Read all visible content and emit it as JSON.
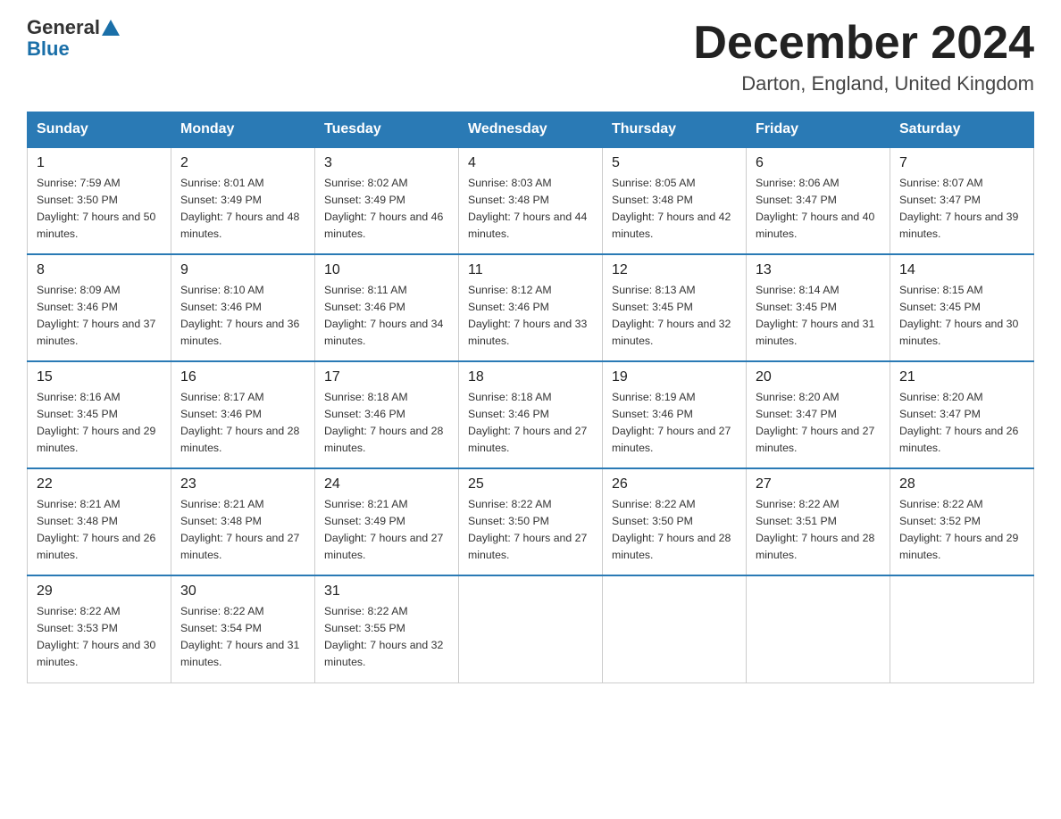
{
  "header": {
    "logo_general": "General",
    "logo_blue": "Blue",
    "month_title": "December 2024",
    "location": "Darton, England, United Kingdom"
  },
  "weekdays": [
    "Sunday",
    "Monday",
    "Tuesday",
    "Wednesday",
    "Thursday",
    "Friday",
    "Saturday"
  ],
  "weeks": [
    [
      {
        "day": 1,
        "sunrise": "7:59 AM",
        "sunset": "3:50 PM",
        "daylight": "7 hours and 50 minutes."
      },
      {
        "day": 2,
        "sunrise": "8:01 AM",
        "sunset": "3:49 PM",
        "daylight": "7 hours and 48 minutes."
      },
      {
        "day": 3,
        "sunrise": "8:02 AM",
        "sunset": "3:49 PM",
        "daylight": "7 hours and 46 minutes."
      },
      {
        "day": 4,
        "sunrise": "8:03 AM",
        "sunset": "3:48 PM",
        "daylight": "7 hours and 44 minutes."
      },
      {
        "day": 5,
        "sunrise": "8:05 AM",
        "sunset": "3:48 PM",
        "daylight": "7 hours and 42 minutes."
      },
      {
        "day": 6,
        "sunrise": "8:06 AM",
        "sunset": "3:47 PM",
        "daylight": "7 hours and 40 minutes."
      },
      {
        "day": 7,
        "sunrise": "8:07 AM",
        "sunset": "3:47 PM",
        "daylight": "7 hours and 39 minutes."
      }
    ],
    [
      {
        "day": 8,
        "sunrise": "8:09 AM",
        "sunset": "3:46 PM",
        "daylight": "7 hours and 37 minutes."
      },
      {
        "day": 9,
        "sunrise": "8:10 AM",
        "sunset": "3:46 PM",
        "daylight": "7 hours and 36 minutes."
      },
      {
        "day": 10,
        "sunrise": "8:11 AM",
        "sunset": "3:46 PM",
        "daylight": "7 hours and 34 minutes."
      },
      {
        "day": 11,
        "sunrise": "8:12 AM",
        "sunset": "3:46 PM",
        "daylight": "7 hours and 33 minutes."
      },
      {
        "day": 12,
        "sunrise": "8:13 AM",
        "sunset": "3:45 PM",
        "daylight": "7 hours and 32 minutes."
      },
      {
        "day": 13,
        "sunrise": "8:14 AM",
        "sunset": "3:45 PM",
        "daylight": "7 hours and 31 minutes."
      },
      {
        "day": 14,
        "sunrise": "8:15 AM",
        "sunset": "3:45 PM",
        "daylight": "7 hours and 30 minutes."
      }
    ],
    [
      {
        "day": 15,
        "sunrise": "8:16 AM",
        "sunset": "3:45 PM",
        "daylight": "7 hours and 29 minutes."
      },
      {
        "day": 16,
        "sunrise": "8:17 AM",
        "sunset": "3:46 PM",
        "daylight": "7 hours and 28 minutes."
      },
      {
        "day": 17,
        "sunrise": "8:18 AM",
        "sunset": "3:46 PM",
        "daylight": "7 hours and 28 minutes."
      },
      {
        "day": 18,
        "sunrise": "8:18 AM",
        "sunset": "3:46 PM",
        "daylight": "7 hours and 27 minutes."
      },
      {
        "day": 19,
        "sunrise": "8:19 AM",
        "sunset": "3:46 PM",
        "daylight": "7 hours and 27 minutes."
      },
      {
        "day": 20,
        "sunrise": "8:20 AM",
        "sunset": "3:47 PM",
        "daylight": "7 hours and 27 minutes."
      },
      {
        "day": 21,
        "sunrise": "8:20 AM",
        "sunset": "3:47 PM",
        "daylight": "7 hours and 26 minutes."
      }
    ],
    [
      {
        "day": 22,
        "sunrise": "8:21 AM",
        "sunset": "3:48 PM",
        "daylight": "7 hours and 26 minutes."
      },
      {
        "day": 23,
        "sunrise": "8:21 AM",
        "sunset": "3:48 PM",
        "daylight": "7 hours and 27 minutes."
      },
      {
        "day": 24,
        "sunrise": "8:21 AM",
        "sunset": "3:49 PM",
        "daylight": "7 hours and 27 minutes."
      },
      {
        "day": 25,
        "sunrise": "8:22 AM",
        "sunset": "3:50 PM",
        "daylight": "7 hours and 27 minutes."
      },
      {
        "day": 26,
        "sunrise": "8:22 AM",
        "sunset": "3:50 PM",
        "daylight": "7 hours and 28 minutes."
      },
      {
        "day": 27,
        "sunrise": "8:22 AM",
        "sunset": "3:51 PM",
        "daylight": "7 hours and 28 minutes."
      },
      {
        "day": 28,
        "sunrise": "8:22 AM",
        "sunset": "3:52 PM",
        "daylight": "7 hours and 29 minutes."
      }
    ],
    [
      {
        "day": 29,
        "sunrise": "8:22 AM",
        "sunset": "3:53 PM",
        "daylight": "7 hours and 30 minutes."
      },
      {
        "day": 30,
        "sunrise": "8:22 AM",
        "sunset": "3:54 PM",
        "daylight": "7 hours and 31 minutes."
      },
      {
        "day": 31,
        "sunrise": "8:22 AM",
        "sunset": "3:55 PM",
        "daylight": "7 hours and 32 minutes."
      },
      null,
      null,
      null,
      null
    ]
  ]
}
